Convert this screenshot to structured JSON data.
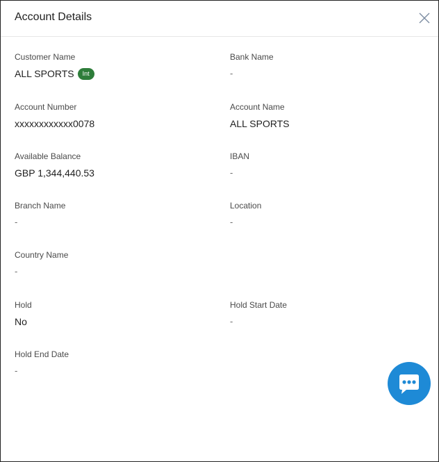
{
  "dialog": {
    "title": "Account Details"
  },
  "fields": {
    "customer_name": {
      "label": "Customer Name",
      "value": "ALL SPORTS",
      "badge": "Int"
    },
    "bank_name": {
      "label": "Bank Name",
      "value": "-"
    },
    "account_number": {
      "label": "Account Number",
      "value": "xxxxxxxxxxxx0078"
    },
    "account_name": {
      "label": "Account Name",
      "value": "ALL SPORTS"
    },
    "available_balance": {
      "label": "Available Balance",
      "value": "GBP 1,344,440.53"
    },
    "iban": {
      "label": "IBAN",
      "value": "-"
    },
    "branch_name": {
      "label": "Branch Name",
      "value": "-"
    },
    "location": {
      "label": "Location",
      "value": "-"
    },
    "country_name": {
      "label": "Country Name",
      "value": "-"
    },
    "hold": {
      "label": "Hold",
      "value": "No"
    },
    "hold_start_date": {
      "label": "Hold Start Date",
      "value": "-"
    },
    "hold_end_date": {
      "label": "Hold End Date",
      "value": "-"
    }
  },
  "icons": {
    "close": "close-icon",
    "chat": "chat-bubble-icon"
  },
  "colors": {
    "badge": "#2e7d3a",
    "chat_fab": "#1e8ad6",
    "border": "#222222"
  }
}
